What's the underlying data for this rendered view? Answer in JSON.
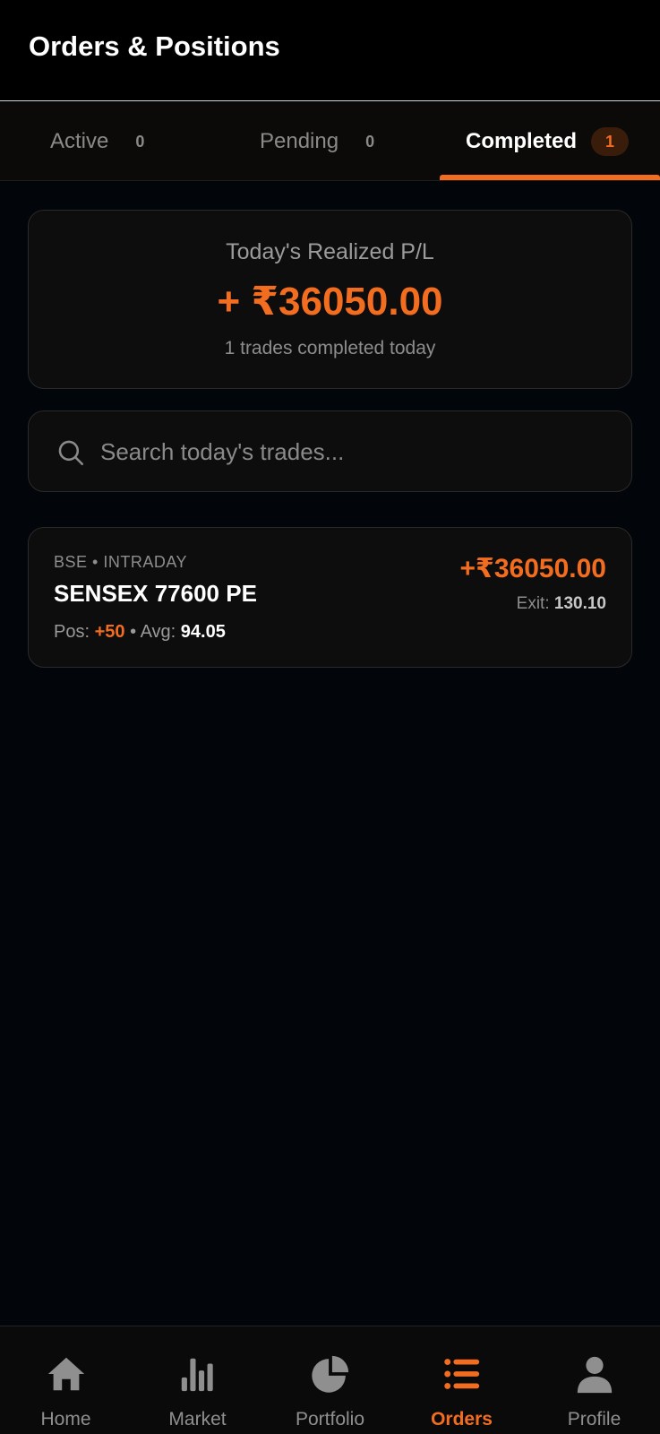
{
  "header": {
    "title": "Orders & Positions"
  },
  "tabs": [
    {
      "label": "Active",
      "count": "0"
    },
    {
      "label": "Pending",
      "count": "0"
    },
    {
      "label": "Completed",
      "count": "1",
      "active": true
    }
  ],
  "summary": {
    "label": "Today's Realized P/L",
    "value": "+ ₹36050.00",
    "subtext": "1 trades completed today"
  },
  "search": {
    "placeholder": "Search today's trades..."
  },
  "trades": [
    {
      "meta": "BSE • INTRADAY",
      "symbol": "SENSEX 77600 PE",
      "pos_label": "Pos:",
      "pos_value": "+50",
      "avg_label": "Avg:",
      "avg_value": "94.05",
      "pnl": "+₹36050.00",
      "exit_label": "Exit:",
      "exit_value": "130.10"
    }
  ],
  "nav": [
    {
      "label": "Home",
      "icon": "home-icon"
    },
    {
      "label": "Market",
      "icon": "bar-chart-icon"
    },
    {
      "label": "Portfolio",
      "icon": "pie-chart-icon"
    },
    {
      "label": "Orders",
      "icon": "list-icon",
      "active": true
    },
    {
      "label": "Profile",
      "icon": "user-icon"
    }
  ],
  "colors": {
    "accent": "#f26d1f",
    "background": "#02060b",
    "card": "#0d0d0d"
  }
}
